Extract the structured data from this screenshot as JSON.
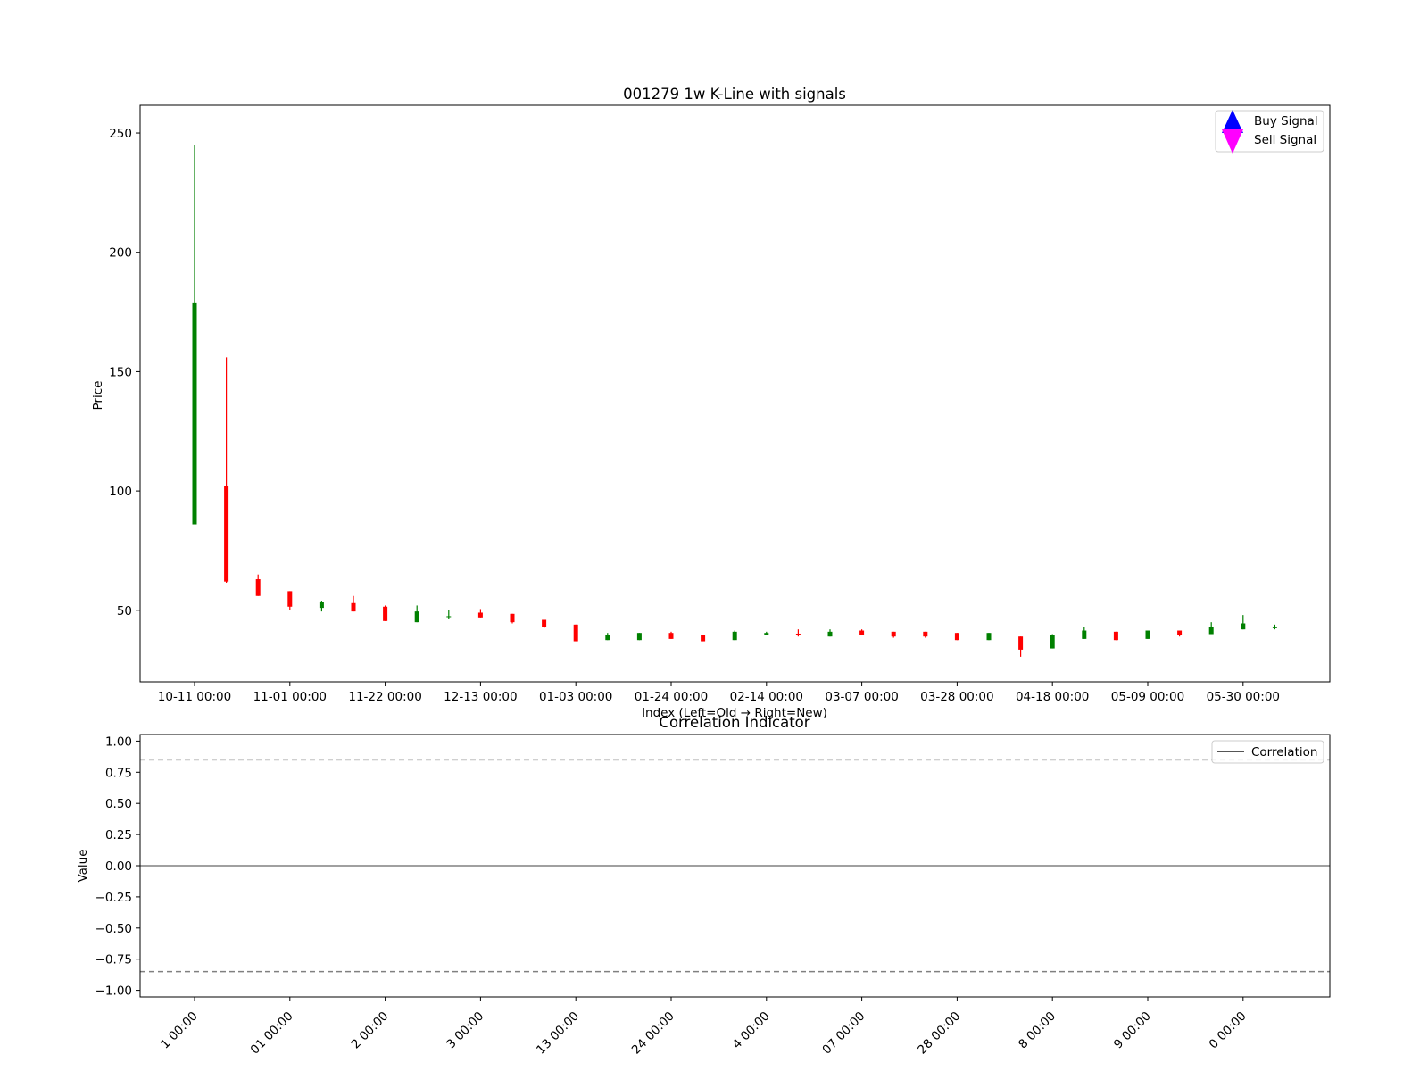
{
  "chart_data": [
    {
      "type": "candlestick",
      "title": "001279 1w K-Line with signals",
      "xlabel": "Index (Left=Old → Right=New)",
      "ylabel": "Price",
      "ylim": [
        20,
        256
      ],
      "yticks": [
        50,
        100,
        150,
        200,
        250
      ],
      "xticks": [
        {
          "index": 0,
          "label": "10-11 00:00"
        },
        {
          "index": 3,
          "label": "11-01 00:00"
        },
        {
          "index": 6,
          "label": "11-22 00:00"
        },
        {
          "index": 9,
          "label": "12-13 00:00"
        },
        {
          "index": 12,
          "label": "01-03 00:00"
        },
        {
          "index": 15,
          "label": "01-24 00:00"
        },
        {
          "index": 18,
          "label": "02-14 00:00"
        },
        {
          "index": 21,
          "label": "03-07 00:00"
        },
        {
          "index": 24,
          "label": "03-28 00:00"
        },
        {
          "index": 27,
          "label": "04-18 00:00"
        },
        {
          "index": 30,
          "label": "05-09 00:00"
        },
        {
          "index": 33,
          "label": "05-30 00:00"
        }
      ],
      "up_color": "#008000",
      "down_color": "#ff0000",
      "candles": [
        {
          "o": 86,
          "c": 179,
          "h": 245,
          "l": 86
        },
        {
          "o": 102,
          "c": 62,
          "h": 156,
          "l": 61.5
        },
        {
          "o": 63,
          "c": 56,
          "h": 65,
          "l": 56
        },
        {
          "o": 58,
          "c": 51.5,
          "h": 58,
          "l": 50
        },
        {
          "o": 51,
          "c": 53.5,
          "h": 54,
          "l": 49.5
        },
        {
          "o": 53,
          "c": 49.5,
          "h": 56,
          "l": 49.5
        },
        {
          "o": 51.5,
          "c": 45.5,
          "h": 52,
          "l": 45.5
        },
        {
          "o": 45,
          "c": 49.5,
          "h": 52,
          "l": 45
        },
        {
          "o": 47.5,
          "c": 47.5,
          "h": 50,
          "l": 46.5
        },
        {
          "o": 49,
          "c": 47,
          "h": 50.5,
          "l": 47
        },
        {
          "o": 48.5,
          "c": 45,
          "h": 48.5,
          "l": 44.5
        },
        {
          "o": 46,
          "c": 43,
          "h": 46,
          "l": 42.5
        },
        {
          "o": 44,
          "c": 37,
          "h": 44,
          "l": 37
        },
        {
          "o": 37.5,
          "c": 39.5,
          "h": 40.5,
          "l": 37.5
        },
        {
          "o": 37.5,
          "c": 40.5,
          "h": 40.5,
          "l": 37.5
        },
        {
          "o": 40.5,
          "c": 38,
          "h": 41,
          "l": 38
        },
        {
          "o": 39.5,
          "c": 37,
          "h": 39.5,
          "l": 37
        },
        {
          "o": 37.5,
          "c": 41,
          "h": 41.5,
          "l": 37.5
        },
        {
          "o": 39.5,
          "c": 40.5,
          "h": 41,
          "l": 39.5
        },
        {
          "o": 40.2,
          "c": 39.8,
          "h": 42,
          "l": 39
        },
        {
          "o": 39,
          "c": 41,
          "h": 42,
          "l": 39
        },
        {
          "o": 41.5,
          "c": 39.5,
          "h": 42,
          "l": 39.5
        },
        {
          "o": 41,
          "c": 39,
          "h": 41,
          "l": 38.5
        },
        {
          "o": 41,
          "c": 39,
          "h": 41,
          "l": 38.5
        },
        {
          "o": 40.5,
          "c": 37.5,
          "h": 40.5,
          "l": 37.5
        },
        {
          "o": 37.5,
          "c": 40.5,
          "h": 40.5,
          "l": 37.5
        },
        {
          "o": 39,
          "c": 33.5,
          "h": 39,
          "l": 30.5
        },
        {
          "o": 34,
          "c": 39.5,
          "h": 40,
          "l": 34
        },
        {
          "o": 38,
          "c": 41.5,
          "h": 43,
          "l": 38
        },
        {
          "o": 41,
          "c": 37.5,
          "h": 41,
          "l": 37.5
        },
        {
          "o": 38,
          "c": 41.5,
          "h": 41.5,
          "l": 38
        },
        {
          "o": 41.5,
          "c": 39.5,
          "h": 41.5,
          "l": 39
        },
        {
          "o": 40,
          "c": 43,
          "h": 45,
          "l": 40
        },
        {
          "o": 42,
          "c": 44.5,
          "h": 48,
          "l": 42
        },
        {
          "o": 42.5,
          "c": 43,
          "h": 44,
          "l": 42
        }
      ],
      "legend": {
        "placement": "top-right",
        "entries": [
          {
            "label": "Buy Signal",
            "marker": "triangle-up",
            "color": "#0000ff"
          },
          {
            "label": "Sell Signal",
            "marker": "triangle-down",
            "color": "#ff00ff"
          }
        ]
      }
    },
    {
      "type": "line",
      "title": "Correlation Indicator",
      "xlabel": "",
      "ylabel": "Value",
      "ylim": [
        -1.05,
        1.05
      ],
      "yticks": [
        1.0,
        0.75,
        0.5,
        0.25,
        0.0,
        -0.25,
        -0.5,
        -0.75,
        -1.0
      ],
      "ytick_labels": [
        "1.00",
        "0.75",
        "0.50",
        "0.25",
        "0.00",
        "−0.25",
        "−0.50",
        "−0.75",
        "−1.00"
      ],
      "xtick_labels_rotated": [
        "1 00:00",
        "01 00:00",
        "2 00:00",
        "3 00:00",
        "13 00:00",
        "24 00:00",
        "4 00:00",
        "07 00:00",
        "28 00:00",
        "8 00:00",
        "9 00:00",
        "0 00:00"
      ],
      "reference_lines": [
        {
          "y": 0.85,
          "style": "dashed",
          "color": "#808080"
        },
        {
          "y": -0.85,
          "style": "dashed",
          "color": "#808080"
        },
        {
          "y": 0.0,
          "style": "solid",
          "color": "#808080"
        }
      ],
      "series": [
        {
          "name": "Correlation",
          "values": [],
          "color": "#555555"
        }
      ],
      "legend": {
        "placement": "top-right"
      }
    }
  ]
}
